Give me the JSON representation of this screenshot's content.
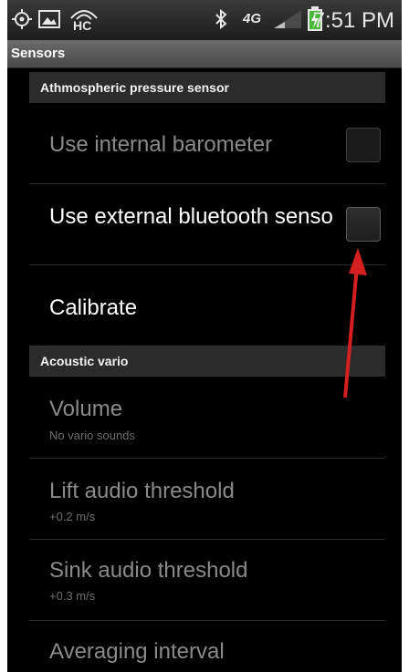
{
  "statusbar": {
    "time": "7:51 PM",
    "hc_label": "HC",
    "network_label": "4G",
    "icons": [
      "gps-icon",
      "gallery-icon",
      "hc-icon",
      "bluetooth-icon",
      "network-4g-icon",
      "signal-icon",
      "battery-charging-icon"
    ]
  },
  "titlebar": {
    "title": "Sensors"
  },
  "sections": {
    "pressure": "Athmospheric pressure sensor",
    "acoustic": "Acoustic vario"
  },
  "prefs": {
    "internal_barometer": {
      "title": "Use internal barometer",
      "checked": false,
      "enabled": false
    },
    "external_bluetooth": {
      "title": "Use external bluetooth sensor",
      "checked": false,
      "enabled": true
    },
    "calibrate": {
      "title": "Calibrate"
    },
    "volume": {
      "title": "Volume",
      "summary": "No vario sounds"
    },
    "lift_threshold": {
      "title": "Lift audio threshold",
      "summary": "+0.2 m/s"
    },
    "sink_threshold": {
      "title": "Sink audio threshold",
      "summary": "+0.3 m/s"
    },
    "averaging_interval": {
      "title": "Averaging interval"
    }
  },
  "colors": {
    "background": "#000000",
    "section": "#2b2b2b",
    "annotation_arrow": "#d42020",
    "charging": "#49b83a"
  }
}
